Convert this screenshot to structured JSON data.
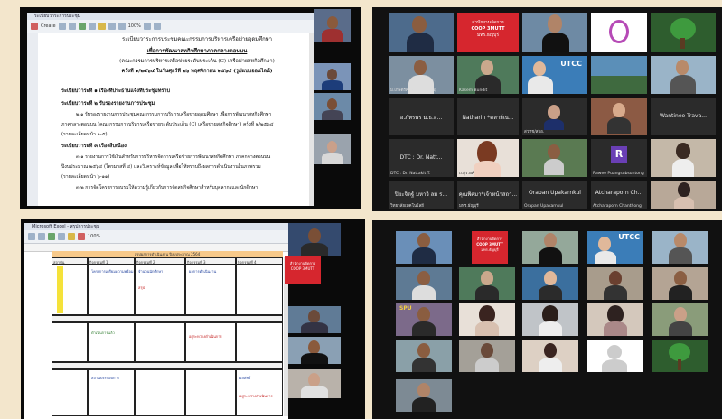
{
  "pdf_panel": {
    "window_title": "ระเบียบวาระการประชุม",
    "toolbar_labels": [
      "Create",
      "100%"
    ],
    "doc_lines": [
      "ระเบียบวาระการประชุมคณะกรรมการบริหารเครือข่ายอุดมศึกษา",
      "เพื่อการพัฒนาสหกิจศึกษาภาคกลางตอนบน",
      "(คณะกรรมการบริหารเครือข่ายระดับประเด็น (C) เครือข่ายสหกิจศึกษา)",
      "ครั้งที่ ๑/๒๕๖๔  ในวันศุกร์ที่ ๒๖ พฤศจิกายน ๒๕๖๔ (รูปแบบออนไลน์)",
      "ระเบียบวาระที่ ๑   เรื่องที่ประธานแจ้งที่ประชุมทราบ",
      "ระเบียบวาระที่ ๒   รับรองรายงานการประชุม",
      "๒.๑  รับรองรายงานการประชุมคณะกรรมการบริหารเครือข่ายอุดมศึกษา  เพื่อการพัฒนาสหกิจศึกษา",
      "ภาคกลางตอนบน (คณะกรรมการบริหารเครือข่ายระดับประเด็น (C) เครือข่ายสหกิจศึกษา) ครั้งที่ ๒/๒๕๖๔",
      "(รายละเอียดหน้า ๑-๕)",
      "ระเบียบวาระที่ ๓   เรื่องสืบเนื่อง",
      "๓.๑  รายงานการใช้เงินสำหรับการบริหารจัดการเครือข่ายการพัฒนาสหกิจศึกษา ภาคกลางตอนบน",
      "ปีงบประมาณ ๒๕๖๔  (ไตรมาสที่ ๔) และวิเคราะห์ข้อมูล  เพื่อให้ทราบถึงผลการดำเนินงานในภาพรวม",
      "(รายละเอียดหน้า ๖-๑๑)",
      "๓.๒  การจัดโครงการอบรมให้ความรู้เกี่ยวกับการจัดสหกิจศึกษาสำหรับบุคลากรและนักศึกษา"
    ]
  },
  "gallery_top": {
    "banner_text": [
      "สำนักงานจัดการ",
      "COOP 3MUTT",
      "มทร.ธัญบุรี"
    ],
    "utcc_label": "UTCC",
    "participants": [
      {
        "label": "ม.เกษตรศาสตร์ (บางเขน)",
        "name": "อ.ภัทรพร ม.ธ.อ..."
      },
      {
        "label": "Kasem Bundit",
        "name": "Natharin *คลาย์เน..."
      },
      {
        "label": "สวทช/สวอ.",
        "name": ""
      },
      {
        "label": "",
        "name": ""
      },
      {
        "label": "",
        "name": "Wantinee Trava..."
      },
      {
        "label": "DTC : Dr. Nattakit T.",
        "name": "DTC : Dr. Natt..."
      },
      {
        "label": "ถ.สุรวงศ์",
        "name": ""
      },
      {
        "label": "",
        "name": ""
      },
      {
        "label": "Rawee Puangsubsuntong",
        "name": "R"
      },
      {
        "label": "",
        "name": ""
      },
      {
        "label": "วิทยาลัยเทคโนโลยี",
        "name": "ปิยะจิตฐ์ มหาวิ ลม ร..."
      },
      {
        "label": "มทร.ธัญบุรี",
        "name": "คุณพิศมา*เจ้าหน้าสถา..."
      },
      {
        "label": "Orapan Upakarnkul",
        "name": "Orapan Upakarnkul"
      },
      {
        "label": "Atcharaporn Chanthong",
        "name": "Atcharaporn Ch..."
      },
      {
        "label": "",
        "name": ""
      }
    ],
    "avatar_letter": "R"
  },
  "sheet_panel": {
    "window_title": "Microsoft Excel - สรุปการประชุม",
    "zoom": "100%",
    "header_text": "สรุปผลการดำเนินงาน ปีงบประมาณ 2564",
    "col_headers": [
      "สถาบัน",
      "กิจกรรมที่ 1",
      "กิจกรรมที่ 2",
      "กิจกรรมที่ 3",
      "กิจกรรมที่ 4"
    ],
    "cell_notes": [
      "สถาบัน",
      "โครงการเตรียมความพร้อม",
      "จำนวนนักศึกษา",
      "ผลการดำเนินงาน",
      "สรุป",
      "ดำเนินการแล้ว",
      "อยู่ระหว่างดำเนินการ",
      "สถานประกอบการ",
      "ผลลัพธ์"
    ]
  },
  "gallery_bottom": {
    "banner_text": [
      "สำนักงานจัดการ",
      "COOP 3MUTT",
      "มทร.ธัญบุรี"
    ],
    "utcc_label": "UTCC",
    "spu_label": "SPU"
  }
}
